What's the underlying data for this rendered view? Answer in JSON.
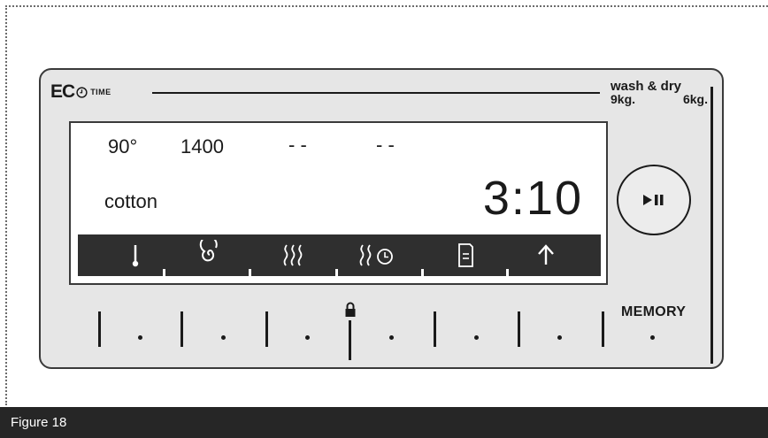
{
  "header": {
    "eco_brand": "EC",
    "eco_clock_icon": "clock-icon",
    "eco_time_label": "TIME",
    "capacity_title": "wash & dry",
    "wash_capacity": "9kg.",
    "dry_capacity": "6kg."
  },
  "display": {
    "temperature": "90°",
    "spin_speed": "1400",
    "option_a": "- -",
    "option_b": "- -",
    "program": "cotton",
    "time": "3:10",
    "icon_bar": [
      {
        "name": "thermometer-icon"
      },
      {
        "name": "spin-spiral-icon"
      },
      {
        "name": "steam-dry-icon"
      },
      {
        "name": "timed-dry-icon"
      },
      {
        "name": "document-icon"
      },
      {
        "name": "up-arrow-icon"
      }
    ]
  },
  "controls": {
    "play_pause_icon": "play-pause-icon",
    "lock_icon": "lock-icon",
    "memory_label": "MEMORY"
  },
  "caption": {
    "text": "Figure 18"
  },
  "colors": {
    "panel_bg": "#e6e6e6",
    "outline": "#1a1a1a",
    "icon_bar_bg": "#2f2f2f",
    "caption_bg": "#262626"
  }
}
